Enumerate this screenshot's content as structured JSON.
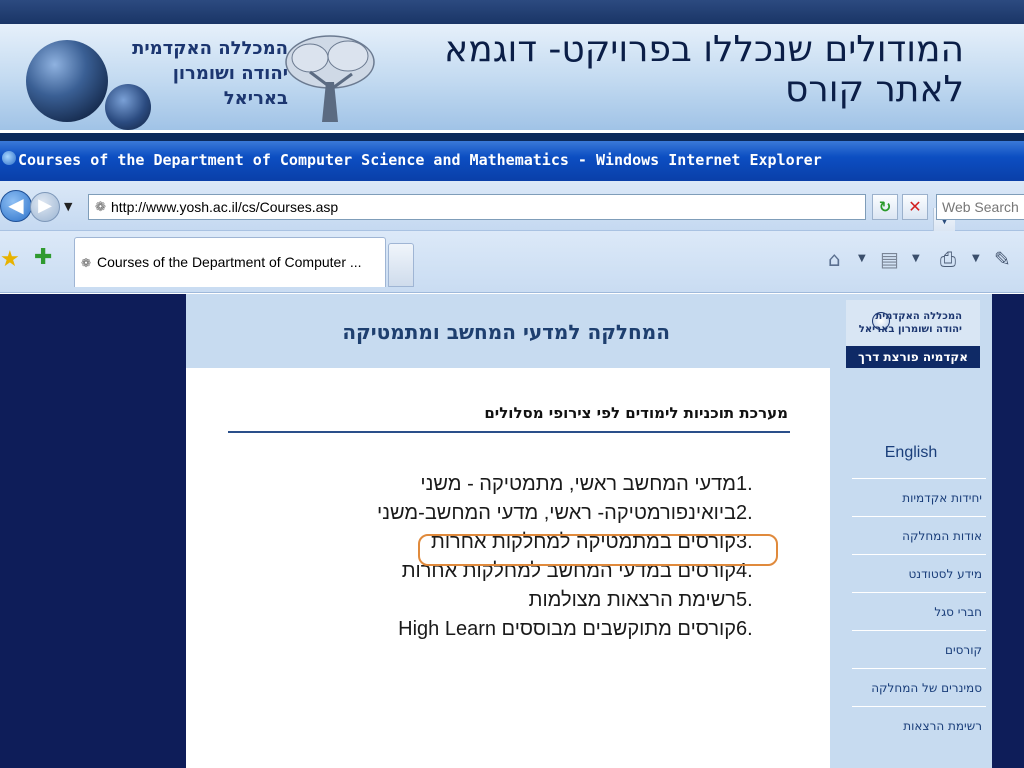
{
  "slide": {
    "title": "המודולים שנכללו בפרויקט- דוגמא לאתר קורס",
    "logo_text": "המכללה האקדמית יהודה ושומרון באריאל"
  },
  "browser": {
    "window_title": "Courses of the Department of Computer Science and Mathematics - Windows Internet Explorer",
    "url": "http://www.yosh.ac.il/cs/Courses.asp",
    "search_placeholder": "Web Search",
    "tab_label": "Courses of the Department of Computer ..."
  },
  "page": {
    "header": "המחלקה למדעי המחשב ומתמטיקה",
    "section_title": "מערכת תוכניות לימודים לפי צירופי מסלולים",
    "courses": [
      {
        "num": "1.",
        "label": "מדעי המחשב ראשי, מתמטיקה - משני"
      },
      {
        "num": "2.",
        "label": "ביואינפורמטיקה- ראשי, מדעי המחשב-משני"
      },
      {
        "num": "3.",
        "label": "קורסים במתמטיקה למחלקות אחרות"
      },
      {
        "num": "4.",
        "label": "קורסים במדעי המחשב למחלקות אחרות"
      },
      {
        "num": "5.",
        "label": "רשימת הרצאות מצולמות"
      },
      {
        "num": "6.",
        "label": "קורסים מתוקשבים מבוססים High Learn"
      }
    ],
    "highlighted_index": 3
  },
  "sidebar": {
    "logo_text": "המכללה האקדמית יהודה ושומרון באריאל",
    "logo_bar": "אקדמיה פורצת דרך",
    "english": "English",
    "menu": [
      {
        "label": "יחידות אקדמיות"
      },
      {
        "label": "אודות המחלקה"
      },
      {
        "label": "מידע לסטודנט"
      },
      {
        "label": "חברי סגל"
      },
      {
        "label": "קורסים"
      },
      {
        "label": "סמינרים של המחלקה"
      },
      {
        "label": "רשימת הרצאות"
      }
    ]
  },
  "colors": {
    "highlight_border": "#e08a3c",
    "page_bg": "#0e1d59",
    "header_bg": "#c7dbf0"
  }
}
